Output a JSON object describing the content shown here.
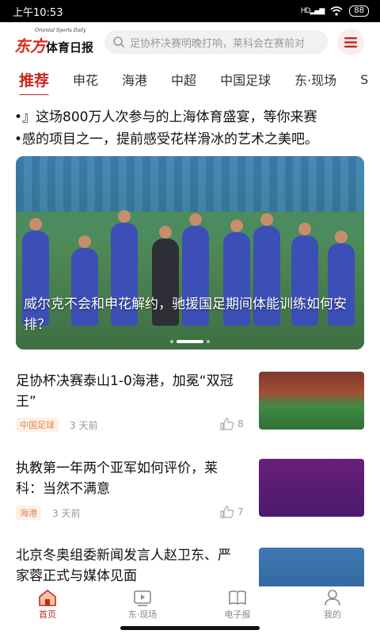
{
  "status_bar": {
    "time": "上午10:53",
    "signal": "HD",
    "battery": "88"
  },
  "header": {
    "logo_en": "Oriental Sports Daily",
    "logo_red": "东方",
    "logo_black": "体育日报",
    "search_placeholder": "足协杯决赛明晚打响，莱科会在赛前对"
  },
  "tabs": [
    {
      "label": "推荐"
    },
    {
      "label": "申花"
    },
    {
      "label": "海港"
    },
    {
      "label": "中超"
    },
    {
      "label": "中国足球"
    },
    {
      "label": "东·现场"
    }
  ],
  "tab_cut": "S",
  "intro": {
    "line1": "•』这场800万人次参与的上海体育盛宴，等你来赛",
    "line2": "•感的项目之一，提前感受花样滑冰的艺术之美吧。"
  },
  "hero": {
    "caption": "威尔克不会和申花解约，驰援国足期间体能训练如何安排？"
  },
  "articles": [
    {
      "title": "足协杯决赛泰山1-0海港，加冕“双冠王”",
      "tag": "中国足球",
      "time": "3 天前",
      "likes": "8"
    },
    {
      "title": "执教第一年两个亚军如何评价，莱科：当然不满意",
      "tag": "海港",
      "time": "3 天前",
      "likes": "7"
    },
    {
      "title": "北京冬奥组委新闻发言人赵卫东、严家蓉正式与媒体见面"
    }
  ],
  "tabbar": [
    {
      "label": "首页",
      "icon": "home-icon"
    },
    {
      "label": "东·现场",
      "icon": "video-icon"
    },
    {
      "label": "电子报",
      "icon": "newspaper-icon"
    },
    {
      "label": "我的",
      "icon": "user-icon"
    }
  ],
  "colors": {
    "accent": "#c8261c",
    "tag_text": "#e0874f",
    "tag_bg": "#fdf0e8"
  }
}
